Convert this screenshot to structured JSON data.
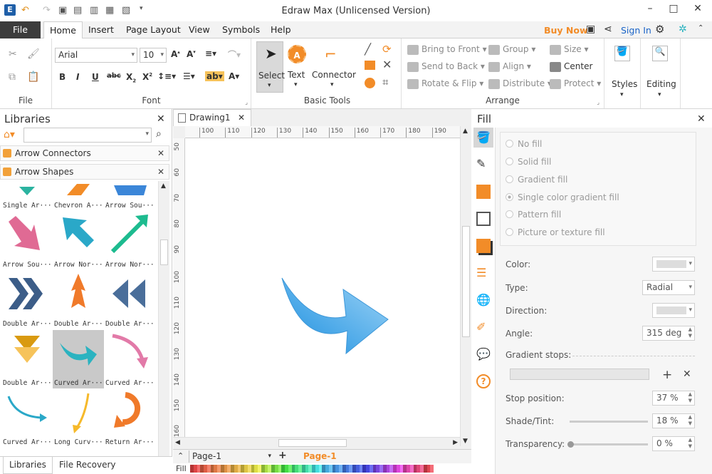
{
  "app": {
    "title": "Edraw Max (Unlicensed Version)"
  },
  "tabs": [
    "File",
    "Home",
    "Insert",
    "Page Layout",
    "View",
    "Symbols",
    "Help"
  ],
  "header_right": {
    "buy_now": "Buy Now",
    "sign_in": "Sign In"
  },
  "ribbon": {
    "groups": {
      "file": "File",
      "font": "Font",
      "basic_tools": "Basic Tools",
      "arrange": "Arrange"
    },
    "font": {
      "family": "Arial",
      "size": "10"
    },
    "tools": {
      "select": "Select",
      "text": "Text",
      "connector": "Connector"
    },
    "arrange": {
      "bring_to_front": "Bring to Front",
      "send_to_back": "Send to Back",
      "rotate_flip": "Rotate & Flip",
      "group": "Group",
      "align": "Align",
      "distribute": "Distribute",
      "size": "Size",
      "center": "Center",
      "protect": "Protect"
    },
    "styles": "Styles",
    "editing": "Editing"
  },
  "libraries": {
    "title": "Libraries",
    "sections": [
      "Arrow Connectors",
      "Arrow Shapes"
    ],
    "shapes": [
      "Single Ar···",
      "Chevron A···",
      "Arrow Sou···",
      "Arrow Sou···",
      "Arrow Nor···",
      "Arrow Nor···",
      "Double Ar···",
      "Double Ar···",
      "Double Ar···",
      "Double Ar···",
      "Curved Ar···",
      "Curved Ar···",
      "Curved Ar···",
      "Long Curv···",
      "Return Ar···"
    ],
    "bottom_tabs": [
      "Libraries",
      "File Recovery"
    ]
  },
  "document": {
    "tab": "Drawing1",
    "ruler_h": [
      "100",
      "110",
      "120",
      "130",
      "140",
      "150",
      "160",
      "170",
      "180",
      "190"
    ],
    "ruler_v": [
      "50",
      "60",
      "70",
      "80",
      "90",
      "100",
      "110",
      "120",
      "130",
      "140",
      "150",
      "160"
    ],
    "page_combo": "Page-1",
    "page_tab": "Page-1",
    "fill_label": "Fill"
  },
  "fill_panel": {
    "title": "Fill",
    "options": [
      "No fill",
      "Solid fill",
      "Gradient fill",
      "Single color gradient fill",
      "Pattern fill",
      "Picture or texture fill"
    ],
    "selected_option": "Single color gradient fill",
    "color_label": "Color:",
    "type_label": "Type:",
    "type_value": "Radial",
    "direction_label": "Direction:",
    "angle_label": "Angle:",
    "angle_value": "315 deg",
    "gradient_stops_label": "Gradient stops:",
    "stop_position_label": "Stop position:",
    "stop_position_value": "37 %",
    "shade_tint_label": "Shade/Tint:",
    "shade_tint_value": "18 %",
    "transparency_label": "Transparency:",
    "transparency_value": "0 %"
  },
  "colors": {
    "accent_orange": "#f28c28",
    "arrow_blue": "#4aa8e8",
    "teal": "#2bb3c0"
  }
}
